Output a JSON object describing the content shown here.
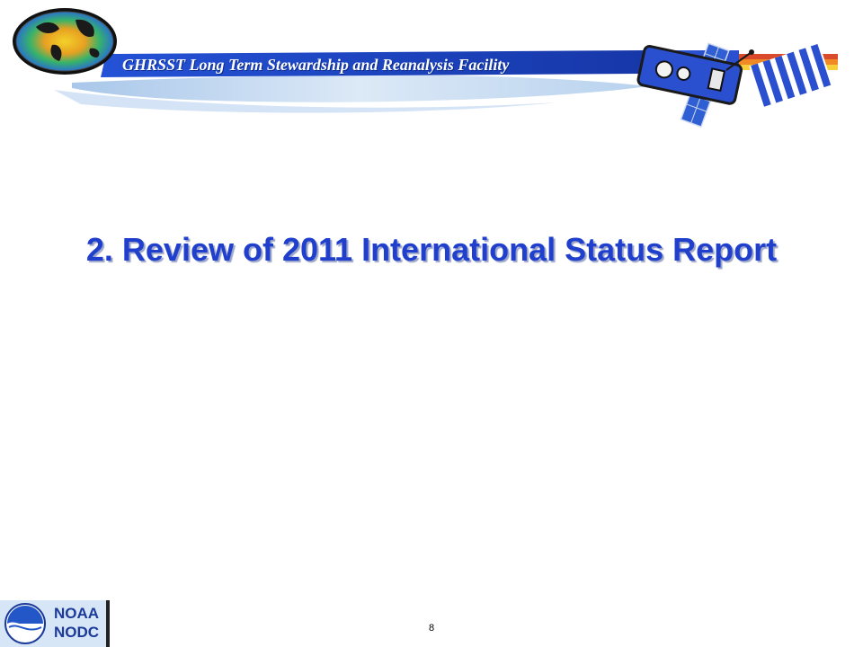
{
  "header": {
    "banner_title": "GHRSST Long Term Stewardship and Reanalysis Facility",
    "globe_icon": "sst-globe-icon",
    "satellite_icon": "satellite-icon",
    "colors": {
      "banner_blue": "#1e46c8",
      "swoosh_light": "#c9dcf2",
      "stripe_red": "#d94b2b",
      "stripe_orange": "#f08a24",
      "stripe_yellow": "#f6cf3a"
    }
  },
  "slide": {
    "title": "2. Review of 2011 International Status Report",
    "title_color": "#1f3fcc"
  },
  "footer": {
    "logo_line_1": "NOAA",
    "logo_line_2": "NODC",
    "logo_icon": "noaa-seal-icon",
    "page_number": "8"
  }
}
